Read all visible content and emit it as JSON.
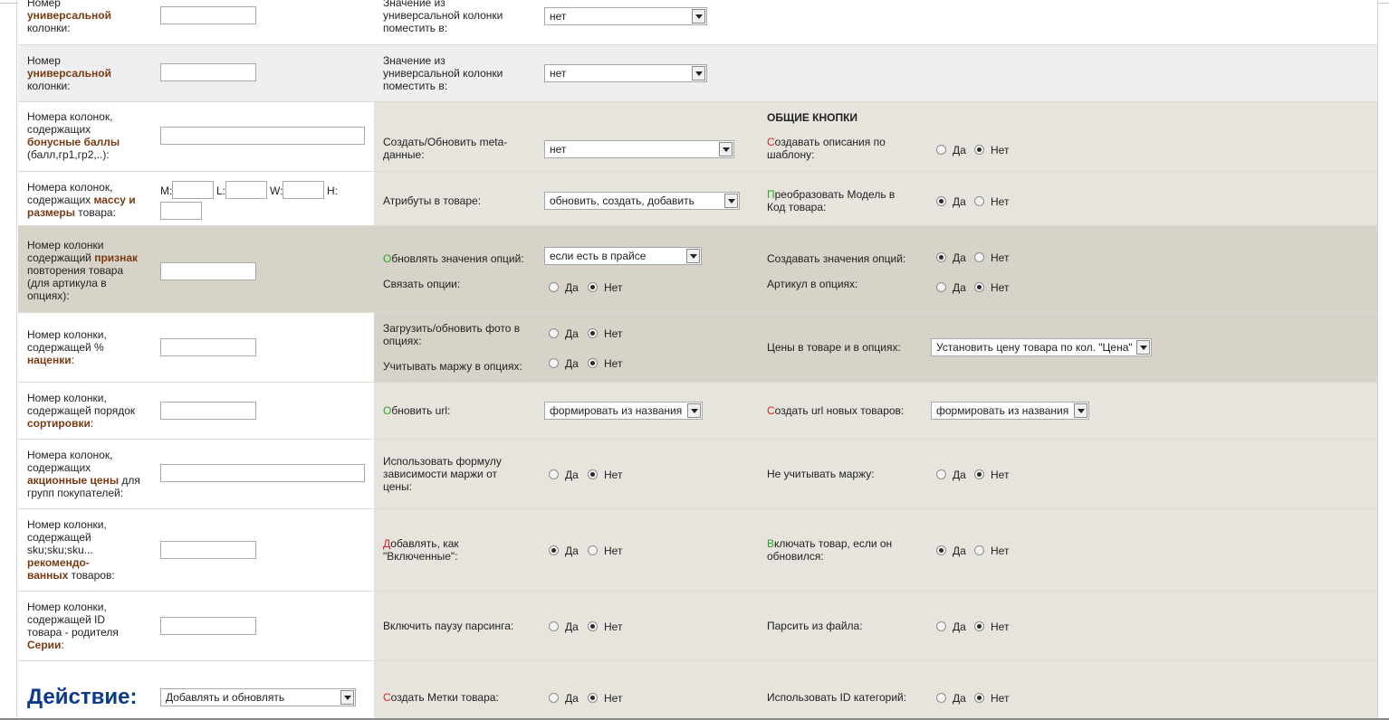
{
  "yes": "Да",
  "no": "Нет",
  "row1": {
    "l1": "Номер",
    "l2": "универсальной",
    "l3": "колонки:",
    "m1": "Значение из",
    "m2": "универсальной колонки",
    "m3": "поместить в:",
    "select": "нет"
  },
  "row2": {
    "l1": "Номер",
    "l2": "универсальной",
    "l3": "колонки:",
    "m1": "Значение из",
    "m2": "универсальной колонки",
    "m3": "поместить в:",
    "select": "нет"
  },
  "row3": {
    "l1": "Номера колонок,",
    "l2": "содержащих",
    "l3": "бонусные баллы",
    "l4": "(балл,гр1,гр2,..):",
    "meta1": "Создать/Обновить meta-",
    "meta2": "данные:",
    "meta_select": "нет",
    "heading": "ОБЩИЕ КНОПКИ",
    "desc_first": "С",
    "desc_rest": "оздавать описания по",
    "desc2": "шаблону:",
    "desc_value": "no"
  },
  "row4": {
    "l1": "Номера колонок,",
    "l2a": "содержащих ",
    "l2b": "массу и",
    "l3a": "размеры",
    "l3b": " товара:",
    "m_label": "M:",
    "l_label": "L:",
    "w_label": "W:",
    "h_label": "H:",
    "attr": "Атрибуты в товаре:",
    "attr_select": "обновить, создать, добавить",
    "conv_first": "П",
    "conv_rest": "реобразовать Модель в",
    "conv2": "Код товара:",
    "conv_value": "yes"
  },
  "row5": {
    "l1": "Номер колонки",
    "l2a": "содержащий ",
    "l2b": "признак",
    "l3": "повторения товара",
    "l4": "(для артикула в",
    "l5": "опциях):",
    "upd_first": "О",
    "upd_rest": "бновлять значения опций:",
    "upd_select": "если есть в прайсе",
    "create_opt": "Создавать значения опций:",
    "create_opt_value": "yes",
    "link_opt": "Связать опции:",
    "link_opt_value": "no",
    "sku_opt": "Артикул в опциях:",
    "sku_opt_value": "no"
  },
  "row6": {
    "l1": "Номер колонки,",
    "l2": "содержащей %",
    "l3": "наценки",
    "l3b": ":",
    "photo1": "Загрузить/обновить фото в",
    "photo2": "опциях:",
    "photo_value": "no",
    "margin": "Учитывать маржу в опциях:",
    "margin_value": "no",
    "prices": "Цены в товаре и в опциях:",
    "prices_select": "Установить цену товара по кол. \"Цена\""
  },
  "row7": {
    "l1": "Номер колонки,",
    "l2": "содержащей порядок",
    "l3": "сортировки",
    "l3b": ":",
    "url_first": "О",
    "url_rest": "бновить url:",
    "url_select": "формировать из названия",
    "newurl_first": "С",
    "newurl_rest": "оздать url новых товаров:",
    "newurl_select": "формировать из названия"
  },
  "row8": {
    "l1": "Номера колонок,",
    "l2": "содержащих",
    "l3a": "акционные цены",
    "l3b": " для",
    "l4": "групп покупателей:",
    "formula1": "Использовать формулу",
    "formula2": "зависимости маржи от",
    "formula3": "цены:",
    "formula_value": "no",
    "nomargin": "Не учитывать маржу:",
    "nomargin_value": "no"
  },
  "row9": {
    "l1": "Номер колонки,",
    "l2": "содержащей",
    "l3": "sku;sku;sku...",
    "l4": "рекомендо-",
    "l5a": "ванных",
    "l5b": " товаров:",
    "add_first": "Д",
    "add_rest": "обавлять, как",
    "add2": "\"Включенные\":",
    "add_value": "yes",
    "incl_first": "В",
    "incl_rest": "ключать товар, если он",
    "incl2": "обновился:",
    "incl_value": "yes"
  },
  "row10": {
    "l1": "Номер колонки,",
    "l2": "содержащей ID",
    "l3": "товара - родителя",
    "l4": "Серии",
    "l4b": ":",
    "pause": "Включить паузу парсинга:",
    "pause_value": "no",
    "file": "Парсить из файла:",
    "file_value": "no"
  },
  "row11": {
    "action": "Действие:",
    "action_select": "Добавлять и обновлять",
    "tags_first": "С",
    "tags_rest": "оздать Метки товара:",
    "tags_value": "no",
    "catid": "Использовать ID категорий:",
    "catid_value": "no"
  }
}
